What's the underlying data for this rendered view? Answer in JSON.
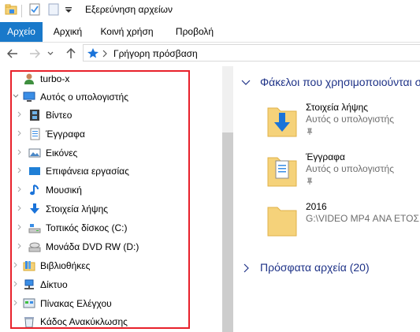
{
  "window": {
    "title": "Εξερεύνηση αρχείων"
  },
  "ribbon": {
    "tabs": [
      {
        "label": "Αρχείο",
        "active": true
      },
      {
        "label": "Αρχική"
      },
      {
        "label": "Κοινή χρήση"
      },
      {
        "label": "Προβολή"
      }
    ]
  },
  "address": {
    "path": "Γρήγορη πρόσβαση"
  },
  "nav": {
    "items": [
      {
        "label": "turbo-x",
        "icon": "user-icon"
      },
      {
        "label": "Αυτός ο υπολογιστής",
        "icon": "computer-icon",
        "expanded": true
      },
      {
        "label": "Βίντεο",
        "icon": "video-icon"
      },
      {
        "label": "Έγγραφα",
        "icon": "documents-icon"
      },
      {
        "label": "Εικόνες",
        "icon": "pictures-icon"
      },
      {
        "label": "Επιφάνεια εργασίας",
        "icon": "desktop-icon"
      },
      {
        "label": "Μουσική",
        "icon": "music-icon"
      },
      {
        "label": "Στοιχεία λήψης",
        "icon": "downloads-icon"
      },
      {
        "label": "Τοπικός δίσκος (C:)",
        "icon": "drive-icon"
      },
      {
        "label": "Μονάδα DVD RW (D:)",
        "icon": "dvd-icon"
      },
      {
        "label": "Βιβλιοθήκες",
        "icon": "libraries-icon"
      },
      {
        "label": "Δίκτυο",
        "icon": "network-icon"
      },
      {
        "label": "Πίνακας Ελέγχου",
        "icon": "control-panel-icon"
      },
      {
        "label": "Κάδος Ανακύκλωσης",
        "icon": "recycle-bin-icon"
      }
    ]
  },
  "content": {
    "frequent": {
      "title": "Φάκελοι που χρησιμοποιούνται συχνά",
      "folders": [
        {
          "name": "Στοιχεία λήψης",
          "location": "Αυτός ο υπολογιστής",
          "pinned": true,
          "icon": "downloads-folder-icon"
        },
        {
          "name": "Έγγραφα",
          "location": "Αυτός ο υπολογιστής",
          "pinned": true,
          "icon": "documents-folder-icon"
        },
        {
          "name": "2016",
          "location": "G:\\VIDEO MP4 ΑΝΑ ΕΤΟΣ",
          "pinned": false,
          "icon": "folder-icon"
        }
      ]
    },
    "recent": {
      "title": "Πρόσφατα αρχεία (20)"
    }
  },
  "colors": {
    "accent": "#1979ca",
    "section_title": "#1e3287",
    "highlight": "#e8212b",
    "folder": "#f5d27a"
  }
}
